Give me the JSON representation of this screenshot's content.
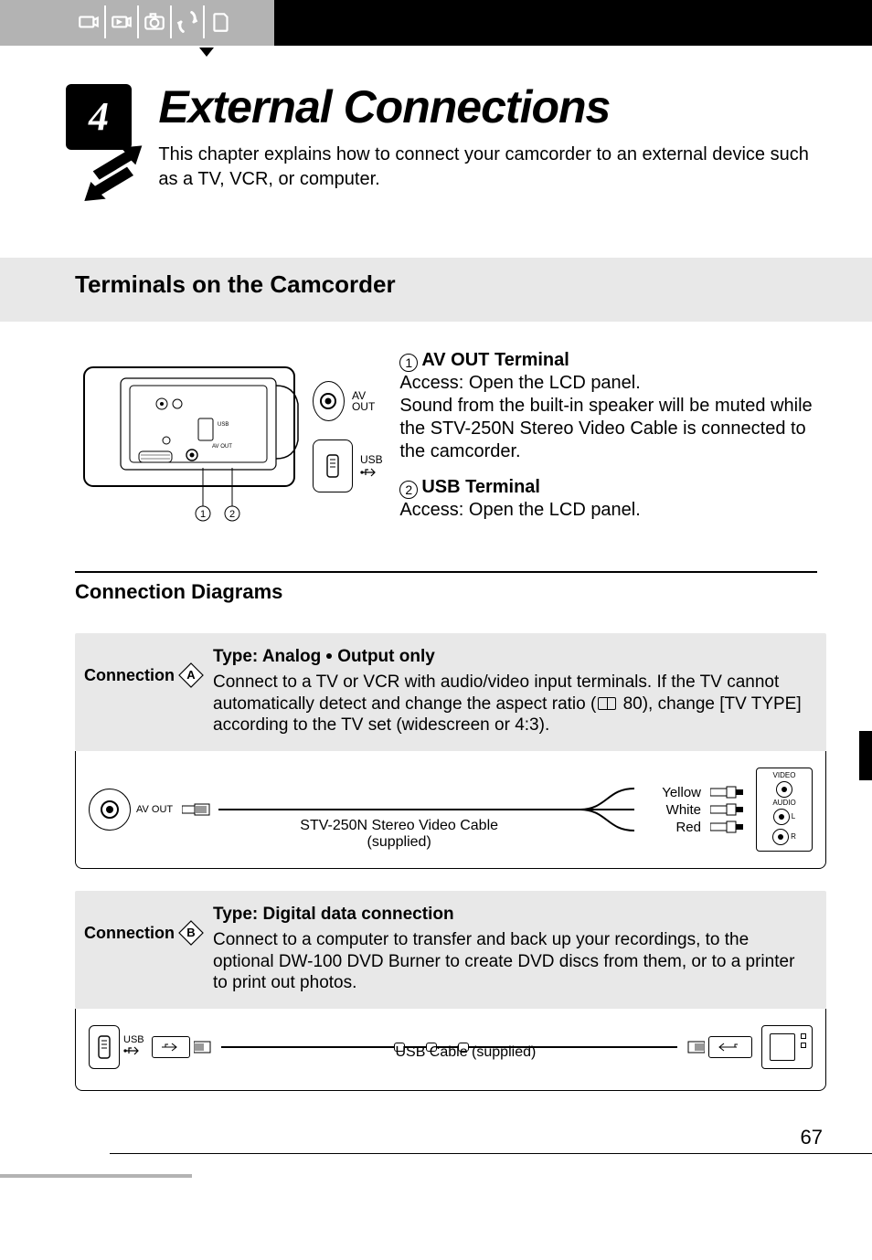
{
  "chapter": {
    "number": "4",
    "title": "External Connections",
    "intro": "This chapter explains how to connect your camcorder to an external device such as a TV, VCR, or computer."
  },
  "section_terminals": {
    "heading": "Terminals on the Camcorder",
    "av_out_port_label": "AV OUT",
    "usb_port_label": "USB",
    "items": [
      {
        "num": "1",
        "title": "AV OUT Terminal",
        "body": "Access: Open the LCD panel.\nSound from the built-in speaker will be muted while the STV-250N Stereo Video Cable is connected to the camcorder."
      },
      {
        "num": "2",
        "title": "USB Terminal",
        "body": "Access: Open the LCD panel."
      }
    ]
  },
  "section_conn": {
    "heading": "Connection Diagrams",
    "A": {
      "label": "Connection",
      "letter": "A",
      "type_prefix": "Type: Analog",
      "type_suffix": "Output only",
      "page_ref": "80",
      "desc_before": "Connect to a TV or VCR with audio/video input terminals. If the TV cannot automatically detect and change the aspect ratio (",
      "desc_after": "), change [TV TYPE] according to the TV set (widescreen or 4:3).",
      "av_out_label": "AV OUT",
      "cable_caption_line1": "STV-250N Stereo Video Cable",
      "cable_caption_line2": "(supplied)",
      "colors": {
        "yellow": "Yellow",
        "white": "White",
        "red": "Red"
      },
      "panel": {
        "video": "VIDEO",
        "audio": "AUDIO",
        "L": "L",
        "R": "R"
      }
    },
    "B": {
      "label": "Connection",
      "letter": "B",
      "type_line": "Type: Digital data connection",
      "desc": "Connect to a computer to transfer and back up your recordings, to the optional DW-100 DVD Burner to create DVD discs from them, or to a printer to print out photos.",
      "usb_label": "USB",
      "cable_caption": "USB Cable (supplied)"
    }
  },
  "page_number": "67"
}
